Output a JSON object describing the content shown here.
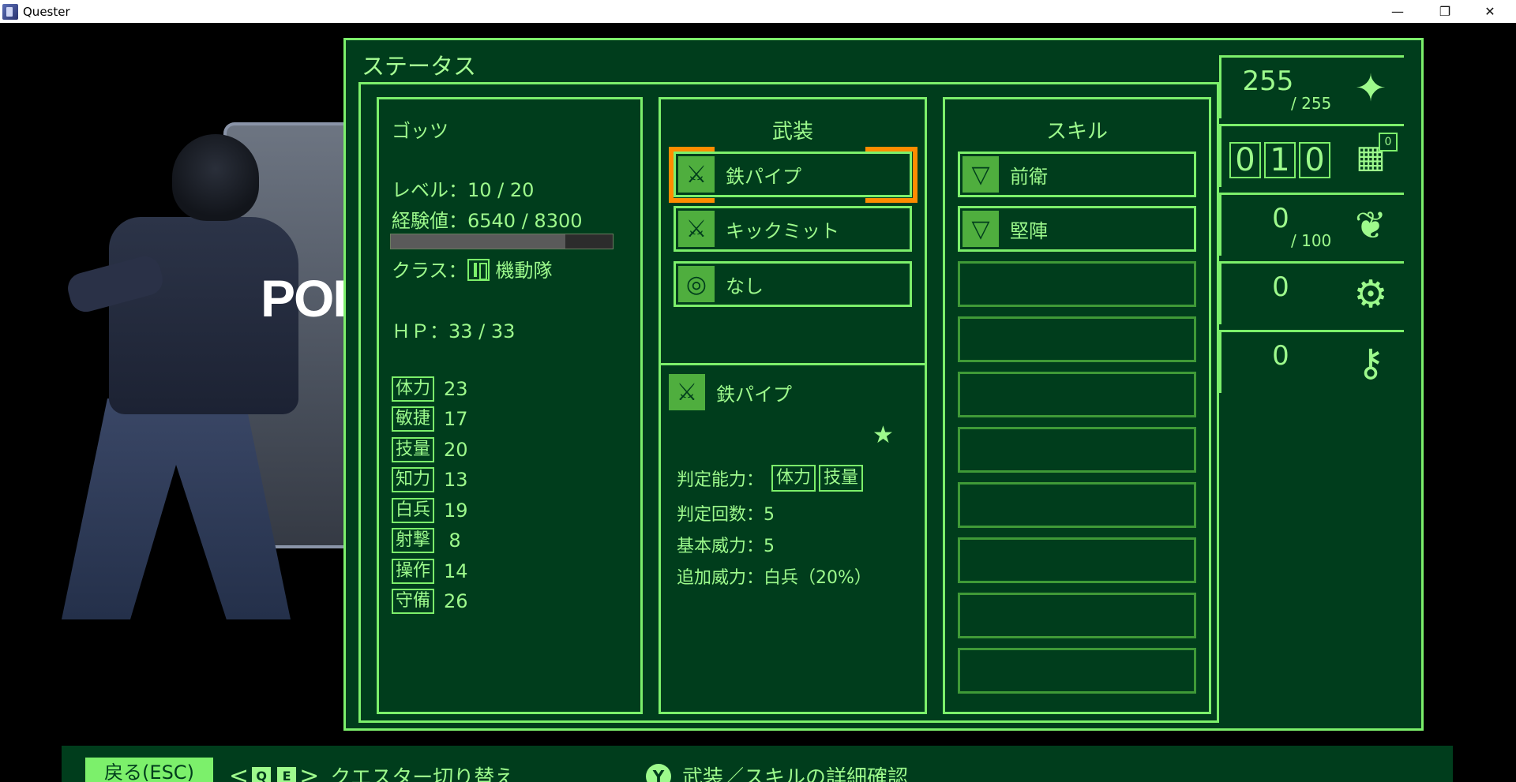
{
  "window": {
    "title": "Quester",
    "min": "—",
    "max": "❐",
    "close": "✕"
  },
  "art": {
    "shield_text": "POLI"
  },
  "panel": {
    "title": "ステータス"
  },
  "character": {
    "name": "ゴッツ",
    "level": "レベル：10 / 20",
    "exp": "経験値：6540 / 8300",
    "exp_fraction": 0.788,
    "class_prefix": "クラス：",
    "class_name": "機動隊",
    "hp": "ＨＰ：33 / 33",
    "stats": [
      {
        "label": "体力",
        "value": "23"
      },
      {
        "label": "敏捷",
        "value": "17"
      },
      {
        "label": "技量",
        "value": "20"
      },
      {
        "label": "知力",
        "value": "13"
      },
      {
        "label": "白兵",
        "value": "19"
      },
      {
        "label": "射撃",
        "value": "8"
      },
      {
        "label": "操作",
        "value": "14"
      },
      {
        "label": "守備",
        "value": "26"
      }
    ]
  },
  "equipment": {
    "title": "武装",
    "slots": [
      {
        "label": "鉄パイプ",
        "icon": "crossed-weapons-icon"
      },
      {
        "label": "キックミット",
        "icon": "crossed-weapons-icon"
      },
      {
        "label": "なし",
        "icon": "armor-icon"
      }
    ],
    "detail": {
      "name": "鉄パイプ",
      "star": "★",
      "judge_label": "判定能力：",
      "judge_tags": [
        "体力",
        "技量"
      ],
      "count": "判定回数：5",
      "power": "基本威力：5",
      "extra": "追加威力：白兵（20%）"
    }
  },
  "skills": {
    "title": "スキル",
    "slots": [
      "前衛",
      "堅陣",
      "",
      "",
      "",
      "",
      "",
      "",
      "",
      ""
    ]
  },
  "resources": {
    "sparkle": {
      "value": "255",
      "max": "/ 255"
    },
    "calendar": {
      "digits": [
        "0",
        "1",
        "0"
      ],
      "badge": "0"
    },
    "fish": {
      "value": "0",
      "max": "/ 100"
    },
    "gears": {
      "value": "0"
    },
    "key": {
      "value": "0"
    }
  },
  "bottom": {
    "back": "戻る(ESC)",
    "switch_q": "Q",
    "switch_e": "E",
    "switch_label": "クエスター切り替え",
    "detail_key": "Y",
    "detail_label": "武装／スキルの詳細確認"
  }
}
